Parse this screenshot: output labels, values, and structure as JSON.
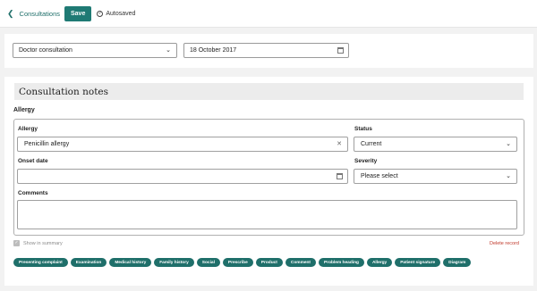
{
  "topbar": {
    "back_label": "Consultations",
    "save_label": "Save",
    "autosaved_label": "Autosaved"
  },
  "consultation": {
    "type_value": "Doctor consultation",
    "date_value": "18 October 2017"
  },
  "notes": {
    "title": "Consultation notes",
    "section_label": "Allergy",
    "allergy_label": "Allergy",
    "allergy_value": "Penicillin allergy",
    "status_label": "Status",
    "status_value": "Current",
    "onset_label": "Onset date",
    "onset_value": "",
    "severity_label": "Severity",
    "severity_value": "Please select",
    "comments_label": "Comments",
    "show_summary_label": "Show in summary",
    "delete_label": "Delete record"
  },
  "chips": [
    "Presenting complaint",
    "Examination",
    "Medical history",
    "Family history",
    "Social",
    "Prescribe",
    "Product",
    "Comment",
    "Problem heading",
    "Allergy",
    "Patient signature",
    "Diagram"
  ],
  "colors": {
    "accent": "#1f7a74",
    "danger": "#c0392b",
    "background": "#f2f2f2"
  }
}
